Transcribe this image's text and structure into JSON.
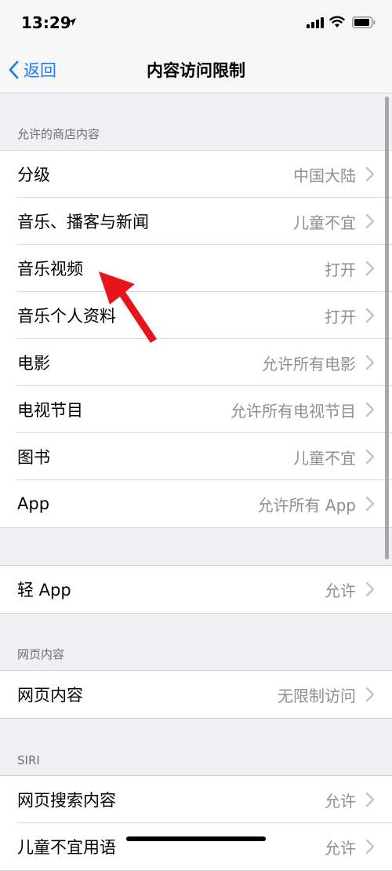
{
  "status": {
    "time": "13:29"
  },
  "nav": {
    "back_label": "返回",
    "title": "内容访问限制"
  },
  "sections": {
    "store": {
      "header": "允许的商店内容",
      "rows": [
        {
          "label": "分级",
          "value": "中国大陆"
        },
        {
          "label": "音乐、播客与新闻",
          "value": "儿童不宜"
        },
        {
          "label": "音乐视频",
          "value": "打开"
        },
        {
          "label": "音乐个人资料",
          "value": "打开"
        },
        {
          "label": "电影",
          "value": "允许所有电影"
        },
        {
          "label": "电视节目",
          "value": "允许所有电视节目"
        },
        {
          "label": "图书",
          "value": "儿童不宜"
        },
        {
          "label": "App",
          "value": "允许所有 App"
        }
      ]
    },
    "appclips": {
      "rows": [
        {
          "label": "轻 App",
          "value": "允许"
        }
      ]
    },
    "web": {
      "header": "网页内容",
      "rows": [
        {
          "label": "网页内容",
          "value": "无限制访问"
        }
      ]
    },
    "siri": {
      "header": "SIRI",
      "rows": [
        {
          "label": "网页搜索内容",
          "value": "允许"
        },
        {
          "label": "儿童不宜用语",
          "value": "允许"
        }
      ]
    }
  },
  "colors": {
    "accent": "#1a7cf5",
    "annotation": "#e8141c"
  },
  "icons": [
    "location-arrow-icon",
    "signal-icon",
    "wifi-icon",
    "battery-icon",
    "chevron-left-icon",
    "chevron-right-icon"
  ]
}
